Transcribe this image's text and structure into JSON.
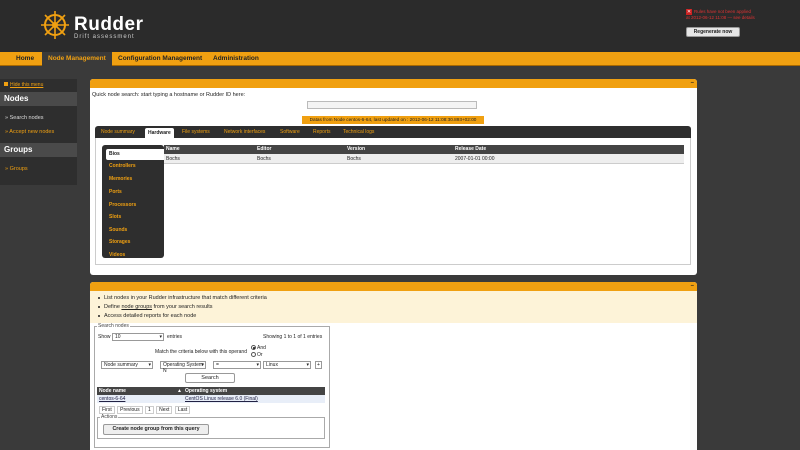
{
  "header": {
    "logo_title": "Rudder",
    "logo_subtitle": "Drift assessment",
    "alert_text": "Rules have not been applied at 2012-06-12 11:08 — see details",
    "regenerate_label": "Regenerate now"
  },
  "nav": {
    "items": [
      "Home",
      "Node Management",
      "Configuration Management",
      "Administration"
    ]
  },
  "sidebar": {
    "hide_menu": "Hide this menu",
    "sections": [
      {
        "title": "Nodes",
        "links": [
          "Search nodes",
          "Accept new nodes"
        ]
      },
      {
        "title": "Groups",
        "links": [
          "Groups"
        ]
      }
    ]
  },
  "top_panel": {
    "quick_search_label": "Quick node search: start typing a hostname or Rudder ID here:",
    "status_text": "Datas from Node centos-6-64, last updated on : 2012-06-12 11:08:30.893+02:00",
    "tabs": [
      "Node summary",
      "Hardware",
      "File systems",
      "Network interfaces",
      "Software",
      "Reports",
      "Technical logs"
    ],
    "subtabs": [
      "Bios",
      "Controllers",
      "Memories",
      "Ports",
      "Processors",
      "Slots",
      "Sounds",
      "Storages",
      "Videos"
    ],
    "bios_table": {
      "headers": [
        "Name",
        "Editor",
        "Version",
        "Release Date"
      ],
      "row": [
        "Bochs",
        "Bochs",
        "Bochs",
        "2007-01-01 00:00"
      ]
    }
  },
  "bottom_panel": {
    "desc": [
      {
        "pre": "List nodes in your Rudder infrastructure that match different criteria",
        "link": "",
        "post": ""
      },
      {
        "pre": "Define ",
        "link": "node groups",
        "post": " from your search results"
      },
      {
        "pre": "Access detailed reports for each node",
        "link": "",
        "post": ""
      }
    ],
    "search_nodes": {
      "legend": "Search nodes",
      "show_label": "Show",
      "show_value": "10",
      "entries_label": "entries",
      "showing": "Showing 1 to 1 of 1 entries",
      "match_label": "Match the criteria below with this operand",
      "and_label": "And",
      "or_label": "Or",
      "criteria": {
        "object": "Node summary",
        "attribute": "Operating System N",
        "comparator": "=",
        "value": "Linux"
      },
      "search_label": "Search",
      "results_headers": [
        "Node name",
        "Operating system"
      ],
      "results_row": [
        "centos-6-64",
        "CentOS Linux release 6.0 (Final)"
      ],
      "pager": [
        "First",
        "Previous",
        "1",
        "Next",
        "Last"
      ],
      "actions_legend": "Actions",
      "create_group_label": "Create node group from this query"
    }
  }
}
